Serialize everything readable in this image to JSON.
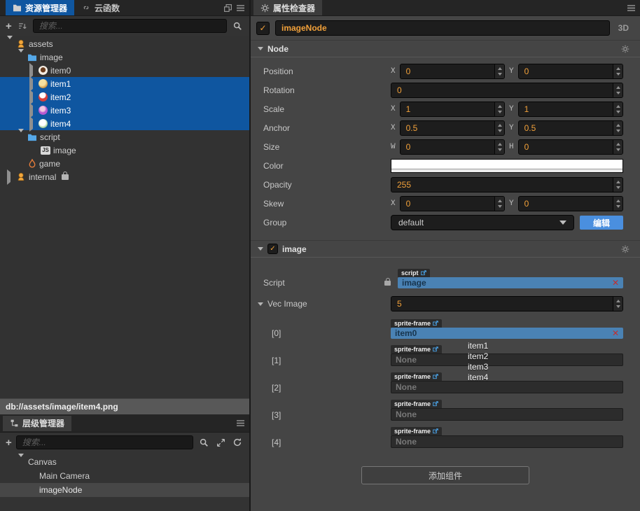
{
  "assets_panel": {
    "tabs": [
      {
        "label": "资源管理器",
        "icon": "folder-icon",
        "active": true
      },
      {
        "label": "云函数",
        "icon": "cloud-function-icon",
        "active": false
      }
    ],
    "search_placeholder": "搜索...",
    "tree": [
      {
        "label": "assets",
        "icon": "assets-db-icon",
        "level": 0,
        "caret": "down"
      },
      {
        "label": "image",
        "icon": "folder-icon",
        "level": 1,
        "caret": "down"
      },
      {
        "label": "item0",
        "icon": "item0-icon",
        "level": 2,
        "caret": "right",
        "selected": false
      },
      {
        "label": "item1",
        "icon": "item1-icon",
        "level": 2,
        "caret": "right",
        "selected": true
      },
      {
        "label": "item2",
        "icon": "item2-icon",
        "level": 2,
        "caret": "right",
        "selected": true
      },
      {
        "label": "item3",
        "icon": "item3-icon",
        "level": 2,
        "caret": "right",
        "selected": true
      },
      {
        "label": "item4",
        "icon": "item4-icon",
        "level": 2,
        "caret": "right",
        "selected": true
      },
      {
        "label": "script",
        "icon": "folder-icon",
        "level": 1,
        "caret": "down"
      },
      {
        "label": "image",
        "icon": "js-file-icon",
        "level": 2
      },
      {
        "label": "game",
        "icon": "fire-icon",
        "level": 1
      },
      {
        "label": "internal",
        "icon": "assets-db-icon",
        "level": 0,
        "caret": "right",
        "locked": true
      }
    ],
    "status_path": "db://assets/image/item4.png"
  },
  "hierarchy_panel": {
    "tab": "层级管理器",
    "search_placeholder": "搜索...",
    "tree": [
      {
        "label": "Canvas",
        "level": 0,
        "caret": "down"
      },
      {
        "label": "Main Camera",
        "level": 1
      },
      {
        "label": "imageNode",
        "level": 1,
        "selected": true
      }
    ]
  },
  "inspector": {
    "tab": "属性检查器",
    "node_name": "imageNode",
    "mode": "3D",
    "check": "✓",
    "node": {
      "title": "Node",
      "rows": [
        {
          "label": "Position",
          "x_label": "X",
          "x": "0",
          "y_label": "Y",
          "y": "0"
        },
        {
          "label": "Rotation",
          "value": "0"
        },
        {
          "label": "Scale",
          "x_label": "X",
          "x": "1",
          "y_label": "Y",
          "y": "1"
        },
        {
          "label": "Anchor",
          "x_label": "X",
          "x": "0.5",
          "y_label": "Y",
          "y": "0.5"
        },
        {
          "label": "Size",
          "x_label": "W",
          "x": "0",
          "y_label": "H",
          "y": "0"
        },
        {
          "label": "Color",
          "value": "#FFFFFF"
        },
        {
          "label": "Opacity",
          "value": "255"
        },
        {
          "label": "Skew",
          "x_label": "X",
          "x": "0",
          "y_label": "Y",
          "y": "0"
        },
        {
          "label": "Group",
          "value": "default",
          "button": "编辑"
        }
      ]
    },
    "image_component": {
      "title": "image",
      "script_label": "Script",
      "script_tag": "script",
      "script_value": "image",
      "vec_label": "Vec Image",
      "vec_count": "5",
      "elements": [
        {
          "index": "[0]",
          "tag": "sprite-frame",
          "value": "item0",
          "filled": true
        },
        {
          "index": "[1]",
          "tag": "sprite-frame",
          "value": "None",
          "filled": false
        },
        {
          "index": "[2]",
          "tag": "sprite-frame",
          "value": "None",
          "filled": false
        },
        {
          "index": "[3]",
          "tag": "sprite-frame",
          "value": "None",
          "filled": false
        },
        {
          "index": "[4]",
          "tag": "sprite-frame",
          "value": "None",
          "filled": false
        }
      ]
    },
    "add_component_label": "添加组件"
  },
  "drag_ghost": {
    "items": [
      "item1",
      "item2",
      "item3",
      "item4"
    ]
  },
  "colors": {
    "selection_blue": "#0f56a0",
    "asset_field_blue": "#4a82b4",
    "accent_orange": "#f2a13a",
    "edit_button_blue": "#4a8fdf",
    "inspector_bg": "#454545"
  }
}
